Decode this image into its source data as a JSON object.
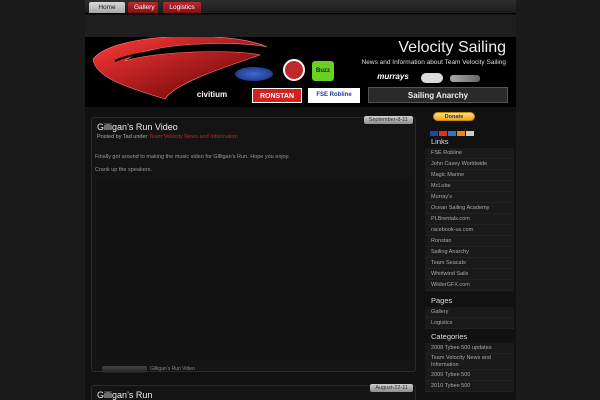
{
  "nav": {
    "home": "Home",
    "gallery": "Gallery",
    "logistics": "Logistics"
  },
  "header": {
    "title": "Velocity Sailing",
    "tagline": "News and Information about Team Velocity Sailing",
    "sponsors": [
      "Buzz",
      "murrays",
      "civitium",
      "RONSTAN",
      "FSE Robline",
      "Sailing Anarchy"
    ]
  },
  "posts": [
    {
      "title": "Gilligan’s Run Video",
      "date": "September-8-11",
      "meta_prefix": "Posted by Tad under",
      "category": "Team Velocity News and Information",
      "body": [
        "Finally got around to making the music video for Gilligan’s Run. Hope you enjoy.",
        "Crank up the speakers."
      ],
      "footer": "Gilligan’s Run Video"
    },
    {
      "title": "Gilligan’s Run",
      "date": "August-22-11"
    }
  ],
  "sidebar": {
    "donate": "Donate",
    "links_heading": "Links",
    "links": [
      "FSE Robline",
      "John Casey Worldwide",
      "Magic Marine",
      "McLube",
      "Murray’s",
      "Ocean Sailing Academy",
      "PLBrentals.com",
      "racebook-us.com",
      "Ronstan",
      "Sailing Anarchy",
      "Team Seacats",
      "Whirlwind Sails",
      "WilderGFX.com"
    ],
    "pages_heading": "Pages",
    "pages": [
      "Gallery",
      "Logistics"
    ],
    "categories_heading": "Categories",
    "categories": [
      "2008 Tybee 500 updates",
      "Team Velocity News and Information",
      "2009 Tybee 500",
      "2010 Tybee 500"
    ]
  },
  "colors": {
    "accent": "#c0272d",
    "background": "#111111"
  }
}
